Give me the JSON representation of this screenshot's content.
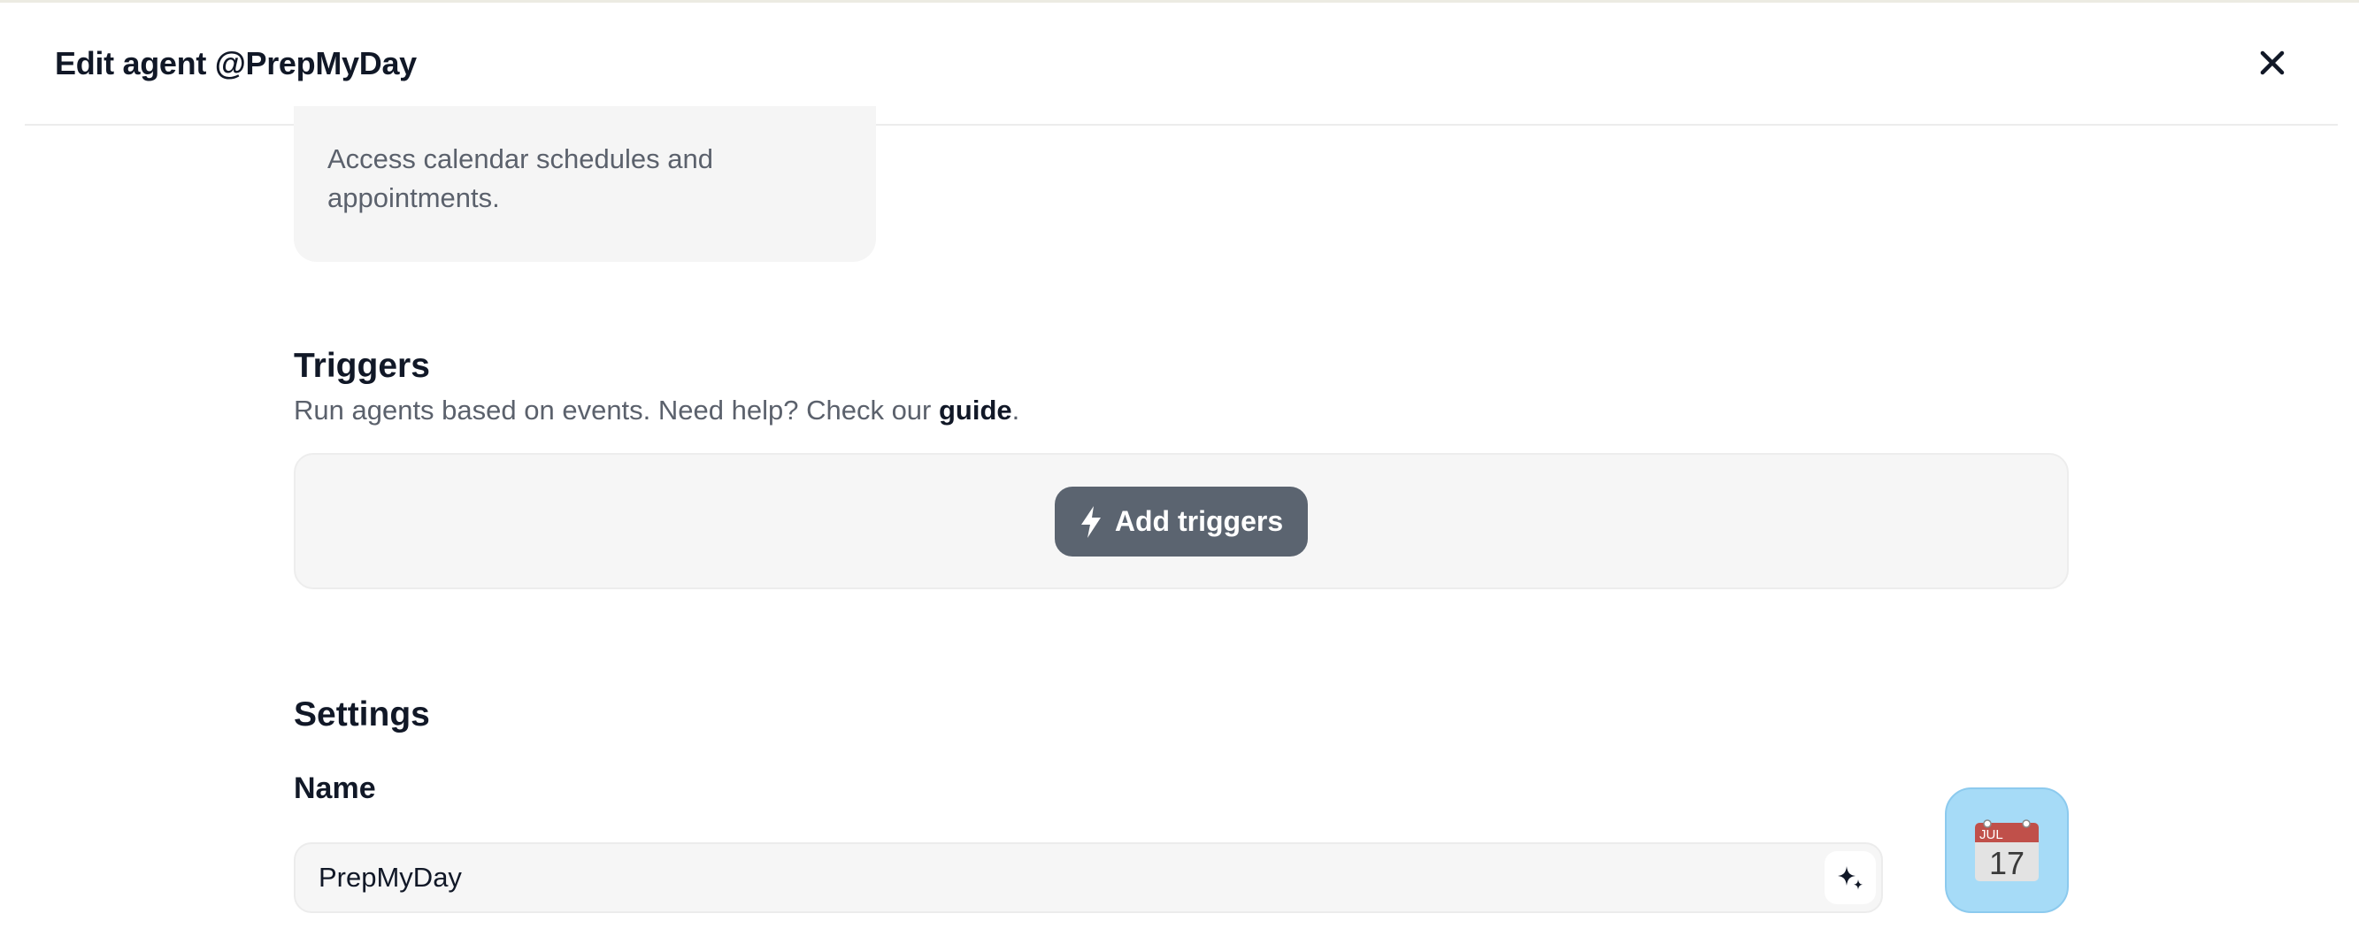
{
  "header": {
    "title": "Edit agent @PrepMyDay",
    "close_icon": "close-icon"
  },
  "tool_card": {
    "description": "Access calendar schedules and appointments."
  },
  "triggers": {
    "title": "Triggers",
    "subtitle_prefix": "Run agents based on events. Need help? Check our ",
    "guide_link": "guide",
    "subtitle_suffix": ".",
    "add_button_label": "Add triggers",
    "add_button_icon": "lightning-bolt-icon"
  },
  "settings": {
    "title": "Settings",
    "name_label": "Name",
    "name_value": "PrepMyDay",
    "generate_icon": "sparkle-icon",
    "avatar": {
      "icon": "calendar-icon",
      "month": "JUL",
      "day": "17",
      "background": "#a6dbf7"
    }
  },
  "colors": {
    "button_bg": "#5b6470",
    "muted_text": "#5b616c",
    "card_bg": "#f5f5f5"
  }
}
